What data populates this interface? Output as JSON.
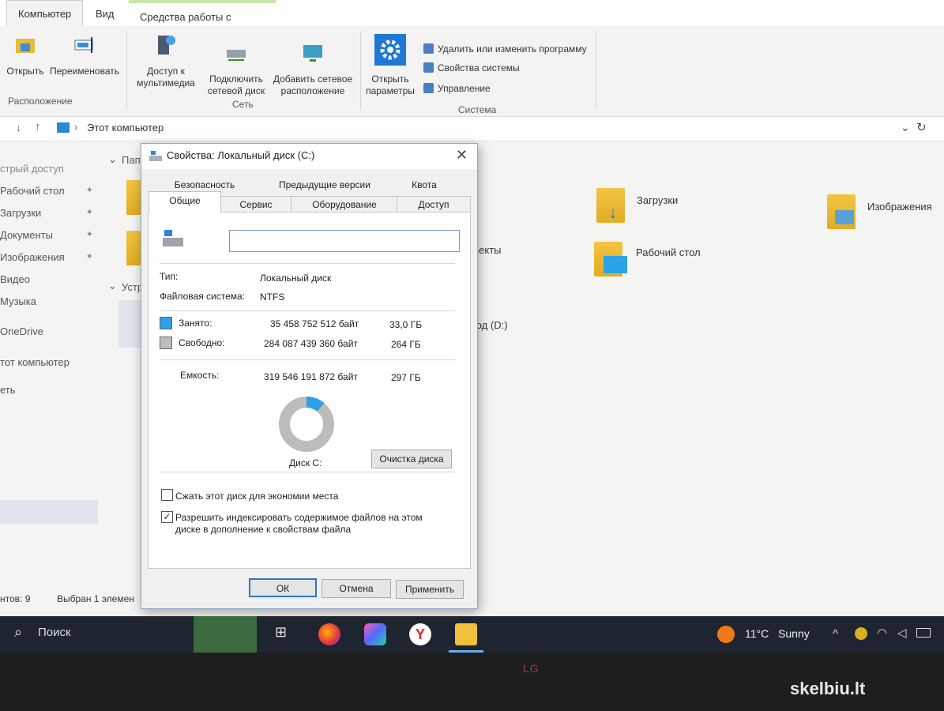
{
  "ribbon": {
    "tabs": [
      "Компьютер",
      "Вид",
      "Средства работы с дисками"
    ],
    "buttons": {
      "open": "Открыть",
      "rename": "Переименовать",
      "media_access": "Доступ к мультимедиа",
      "map_drive": "Подключить сетевой диск",
      "add_location": "Добавить сетевое расположение",
      "open_settings": "Открыть параметры"
    },
    "system_items": [
      "Удалить или изменить программу",
      "Свойства системы",
      "Управление"
    ],
    "groups": {
      "location": "Расположение",
      "network": "Сеть",
      "system": "Система"
    }
  },
  "address": {
    "path": "Этот компьютер"
  },
  "sidebar": {
    "items": [
      "стрый доступ",
      "Рабочий стол",
      "Загрузки",
      "Документы",
      "Изображения",
      "Видео",
      "Музыка",
      "OneDrive",
      "тот компьютер",
      "еть"
    ]
  },
  "content": {
    "section_folders": "Папки",
    "section_devices": "Устр",
    "items": [
      "Загрузки",
      "Изображения",
      "Рабочий стол",
      "ъекты",
      "вод (D:)"
    ]
  },
  "statusbar": {
    "count": "нтов: 9",
    "selected": "Выбран 1 элемен"
  },
  "dialog": {
    "title": "Свойства: Локальный диск (C:)",
    "tabs_row1": [
      "Безопасность",
      "Предыдущие версии",
      "Квота"
    ],
    "tabs_row2": [
      "Общие",
      "Сервис",
      "Оборудование",
      "Доступ"
    ],
    "name_value": "",
    "type_label": "Тип:",
    "type_value": "Локальный диск",
    "fs_label": "Файловая система:",
    "fs_value": "NTFS",
    "used_label": "Занято:",
    "used_bytes": "35 458 752 512 байт",
    "used_gb": "33,0 ГБ",
    "free_label": "Свободно:",
    "free_bytes": "284 087 439 360 байт",
    "free_gb": "264 ГБ",
    "capacity_label": "Емкость:",
    "capacity_bytes": "319 546 191 872 байт",
    "capacity_gb": "297 ГБ",
    "disk_label": "Диск C:",
    "cleanup_button": "Очистка диска",
    "compress_label": "Сжать этот диск для экономии места",
    "index_label_1": "Разрешить индексировать содержимое файлов на этом",
    "index_label_2": "диске в дополнение к свойствам файла",
    "compress_checked": false,
    "index_checked": true,
    "ok": "ОК",
    "cancel": "Отмена",
    "apply": "Применить",
    "used_fraction": 0.111,
    "colors": {
      "used": "#2ea1e6",
      "free": "#bcbcbc"
    }
  },
  "taskbar": {
    "search": "Поиск",
    "temp": "11°C",
    "weather": "Sunny"
  },
  "monitor": {
    "brand": "LG"
  },
  "watermark": "skelbiu.lt"
}
